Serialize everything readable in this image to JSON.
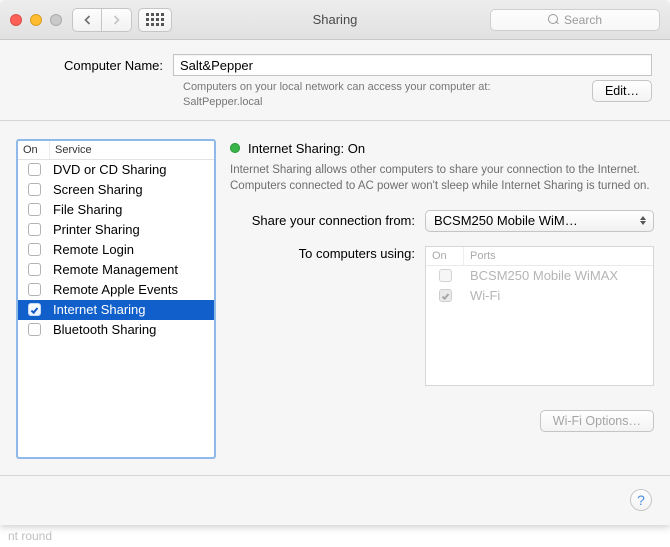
{
  "window": {
    "title": "Sharing",
    "search_placeholder": "Search"
  },
  "computer_name": {
    "label": "Computer Name:",
    "value": "Salt&Pepper",
    "note_line1": "Computers on your local network can access your computer at:",
    "note_line2": "SaltPepper.local",
    "edit_label": "Edit…"
  },
  "services": {
    "header_on": "On",
    "header_svc": "Service",
    "items": [
      {
        "on": false,
        "label": "DVD or CD Sharing",
        "selected": false
      },
      {
        "on": false,
        "label": "Screen Sharing",
        "selected": false
      },
      {
        "on": false,
        "label": "File Sharing",
        "selected": false
      },
      {
        "on": false,
        "label": "Printer Sharing",
        "selected": false
      },
      {
        "on": false,
        "label": "Remote Login",
        "selected": false
      },
      {
        "on": false,
        "label": "Remote Management",
        "selected": false
      },
      {
        "on": false,
        "label": "Remote Apple Events",
        "selected": false
      },
      {
        "on": true,
        "label": "Internet Sharing",
        "selected": true
      },
      {
        "on": false,
        "label": "Bluetooth Sharing",
        "selected": false
      }
    ]
  },
  "detail": {
    "status_title": "Internet Sharing: On",
    "status_color": "green",
    "description": "Internet Sharing allows other computers to share your connection to the Internet. Computers connected to AC power won't sleep while Internet Sharing is turned on.",
    "from_label": "Share your connection from:",
    "from_value": "BCSM250 Mobile WiM…",
    "to_label": "To computers using:",
    "ports": {
      "header_on": "On",
      "header_name": "Ports",
      "items": [
        {
          "on": false,
          "label": "BCSM250 Mobile WiMAX"
        },
        {
          "on": true,
          "label": "Wi-Fi"
        }
      ]
    },
    "wifi_options_label": "Wi-Fi Options…"
  },
  "footer": {
    "help_label": "?",
    "bg_text": "nt round"
  }
}
